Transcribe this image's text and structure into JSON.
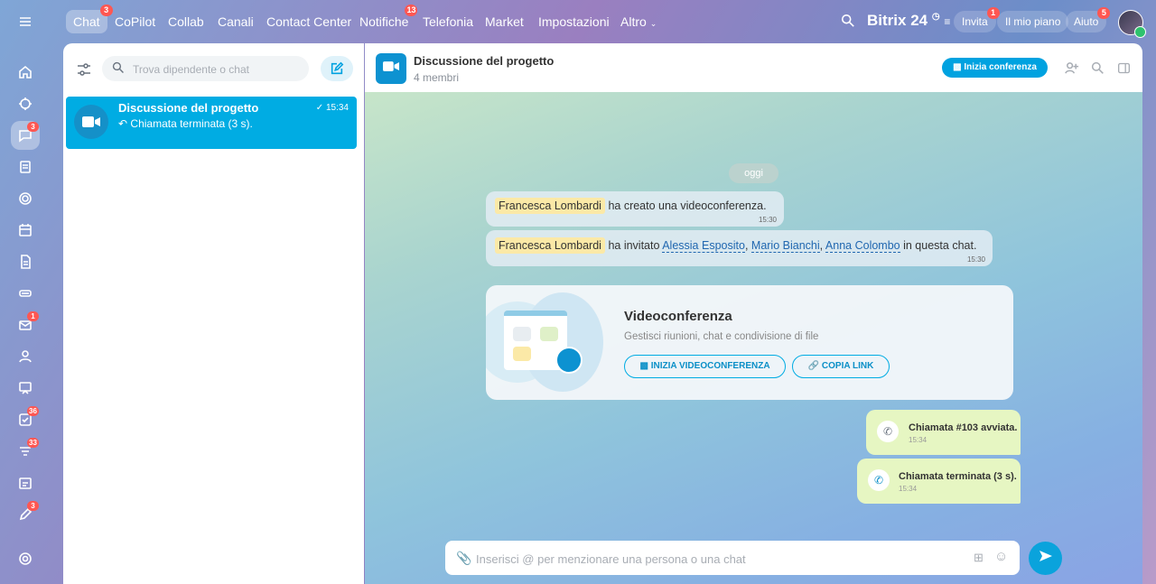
{
  "topbar": {
    "nav": [
      {
        "label": "Chat",
        "badge": "3"
      },
      {
        "label": "CoPilot",
        "badge": ""
      },
      {
        "label": "Collab",
        "badge": ""
      },
      {
        "label": "Canali",
        "badge": ""
      },
      {
        "label": "Contact Center",
        "badge": ""
      },
      {
        "label": "Notifiche",
        "badge": "13"
      },
      {
        "label": "Telefonia",
        "badge": ""
      },
      {
        "label": "Market",
        "badge": ""
      },
      {
        "label": "Impostazioni",
        "badge": ""
      },
      {
        "label": "Altro",
        "badge": ""
      }
    ],
    "brand": "Bitrix",
    "brand_num": "24",
    "invite_label": "Invita",
    "invite_badge": "1",
    "plan_label": "Il mio piano",
    "help_label": "Aiuto",
    "help_badge": "5"
  },
  "rail": {
    "badges": {
      "chat": "3",
      "mail": "1",
      "tasks": "36",
      "feed": "33",
      "edit": "3"
    }
  },
  "sidebar": {
    "search_placeholder": "Trova dipendente o chat",
    "chats": [
      {
        "title": "Discussione del progetto",
        "preview": "Chiamata terminata (3 s).",
        "time": "15:34"
      }
    ]
  },
  "chat": {
    "title": "Discussione del progetto",
    "subtitle": "4 membri",
    "start_conference_label": "Inizia conferenza",
    "date_separator": "oggi",
    "messages": {
      "m1": {
        "author": "Francesca Lombardi",
        "text": "ha creato una videoconferenza.",
        "time": "15:30"
      },
      "m2": {
        "author": "Francesca Lombardi",
        "text_before": "ha invitato",
        "invitees": [
          "Alessia Esposito",
          "Mario Bianchi",
          "Anna Colombo"
        ],
        "sep": ",",
        "text_after": "in questa chat.",
        "time": "15:30"
      }
    },
    "video_card": {
      "title": "Videoconferenza",
      "subtitle": "Gestisci riunioni, chat e condivisione di file",
      "start_btn": "INIZIA VIDEOCONFERENZA",
      "copy_btn": "COPIA LINK"
    },
    "calls": [
      {
        "text": "Chiamata #103 avviata.",
        "time": "15:34"
      },
      {
        "text": "Chiamata terminata (3 s).",
        "time": "15:34"
      }
    ],
    "input_placeholder": "Inserisci @ per menzionare una persona o una chat"
  },
  "colors": {
    "accent": "#00ace3",
    "badge": "#ff5752",
    "highlight": "#fbe9a7"
  }
}
